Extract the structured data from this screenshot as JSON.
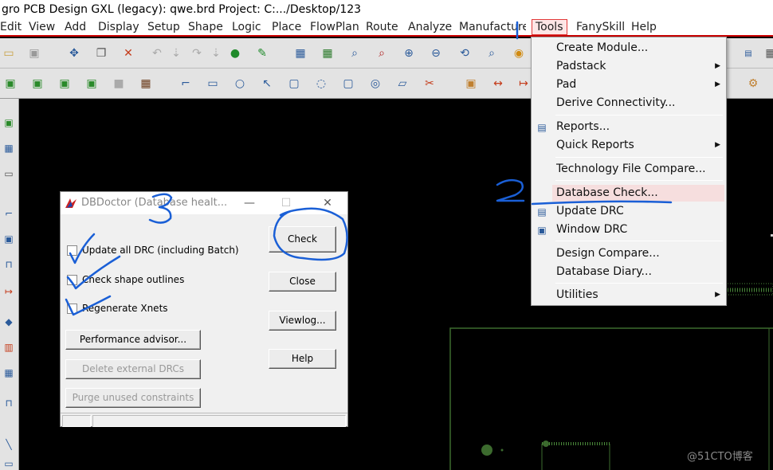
{
  "app": {
    "title": "gro PCB Design GXL (legacy): qwe.brd  Project: C:.../Desktop/123"
  },
  "menubar": {
    "items": [
      "Edit",
      "View",
      "Add",
      "Display",
      "Setup",
      "Shape",
      "Logic",
      "Place",
      "FlowPlan",
      "Route",
      "Analyze",
      "Manufacture",
      "Tools",
      "FanySkill",
      "Help"
    ],
    "active": "Tools"
  },
  "tools_menu": {
    "items": [
      "Create Module...",
      "Padstack",
      "Pad",
      "Derive Connectivity...",
      "Reports...",
      "Quick Reports",
      "Technology File Compare...",
      "Database Check...",
      "Update DRC",
      "Window DRC",
      "Design Compare...",
      "Database Diary...",
      "Utilities"
    ],
    "highlighted": "Database Check...",
    "submenu_items": [
      "Padstack",
      "Pad",
      "Quick Reports",
      "Utilities"
    ]
  },
  "dialog": {
    "title": "DBDoctor (Database healt...",
    "checkboxes": [
      "Update all DRC (including Batch)",
      "Check shape outlines",
      "Regenerate Xnets"
    ],
    "buttons": {
      "performance": "Performance advisor...",
      "delete_drc": "Delete external DRCs",
      "purge": "Purge unused constraints",
      "check": "Check",
      "close": "Close",
      "viewlog": "Viewlog...",
      "help": "Help"
    }
  },
  "annotations": {
    "step2": "2",
    "step3": "3"
  },
  "watermark": "@51CTO博客",
  "colors": {
    "highlight": "#f6dede",
    "menu_active_border": "#e23a3a",
    "annotation_ink": "#1a5fd6",
    "board_outline": "#3c6b2e"
  }
}
